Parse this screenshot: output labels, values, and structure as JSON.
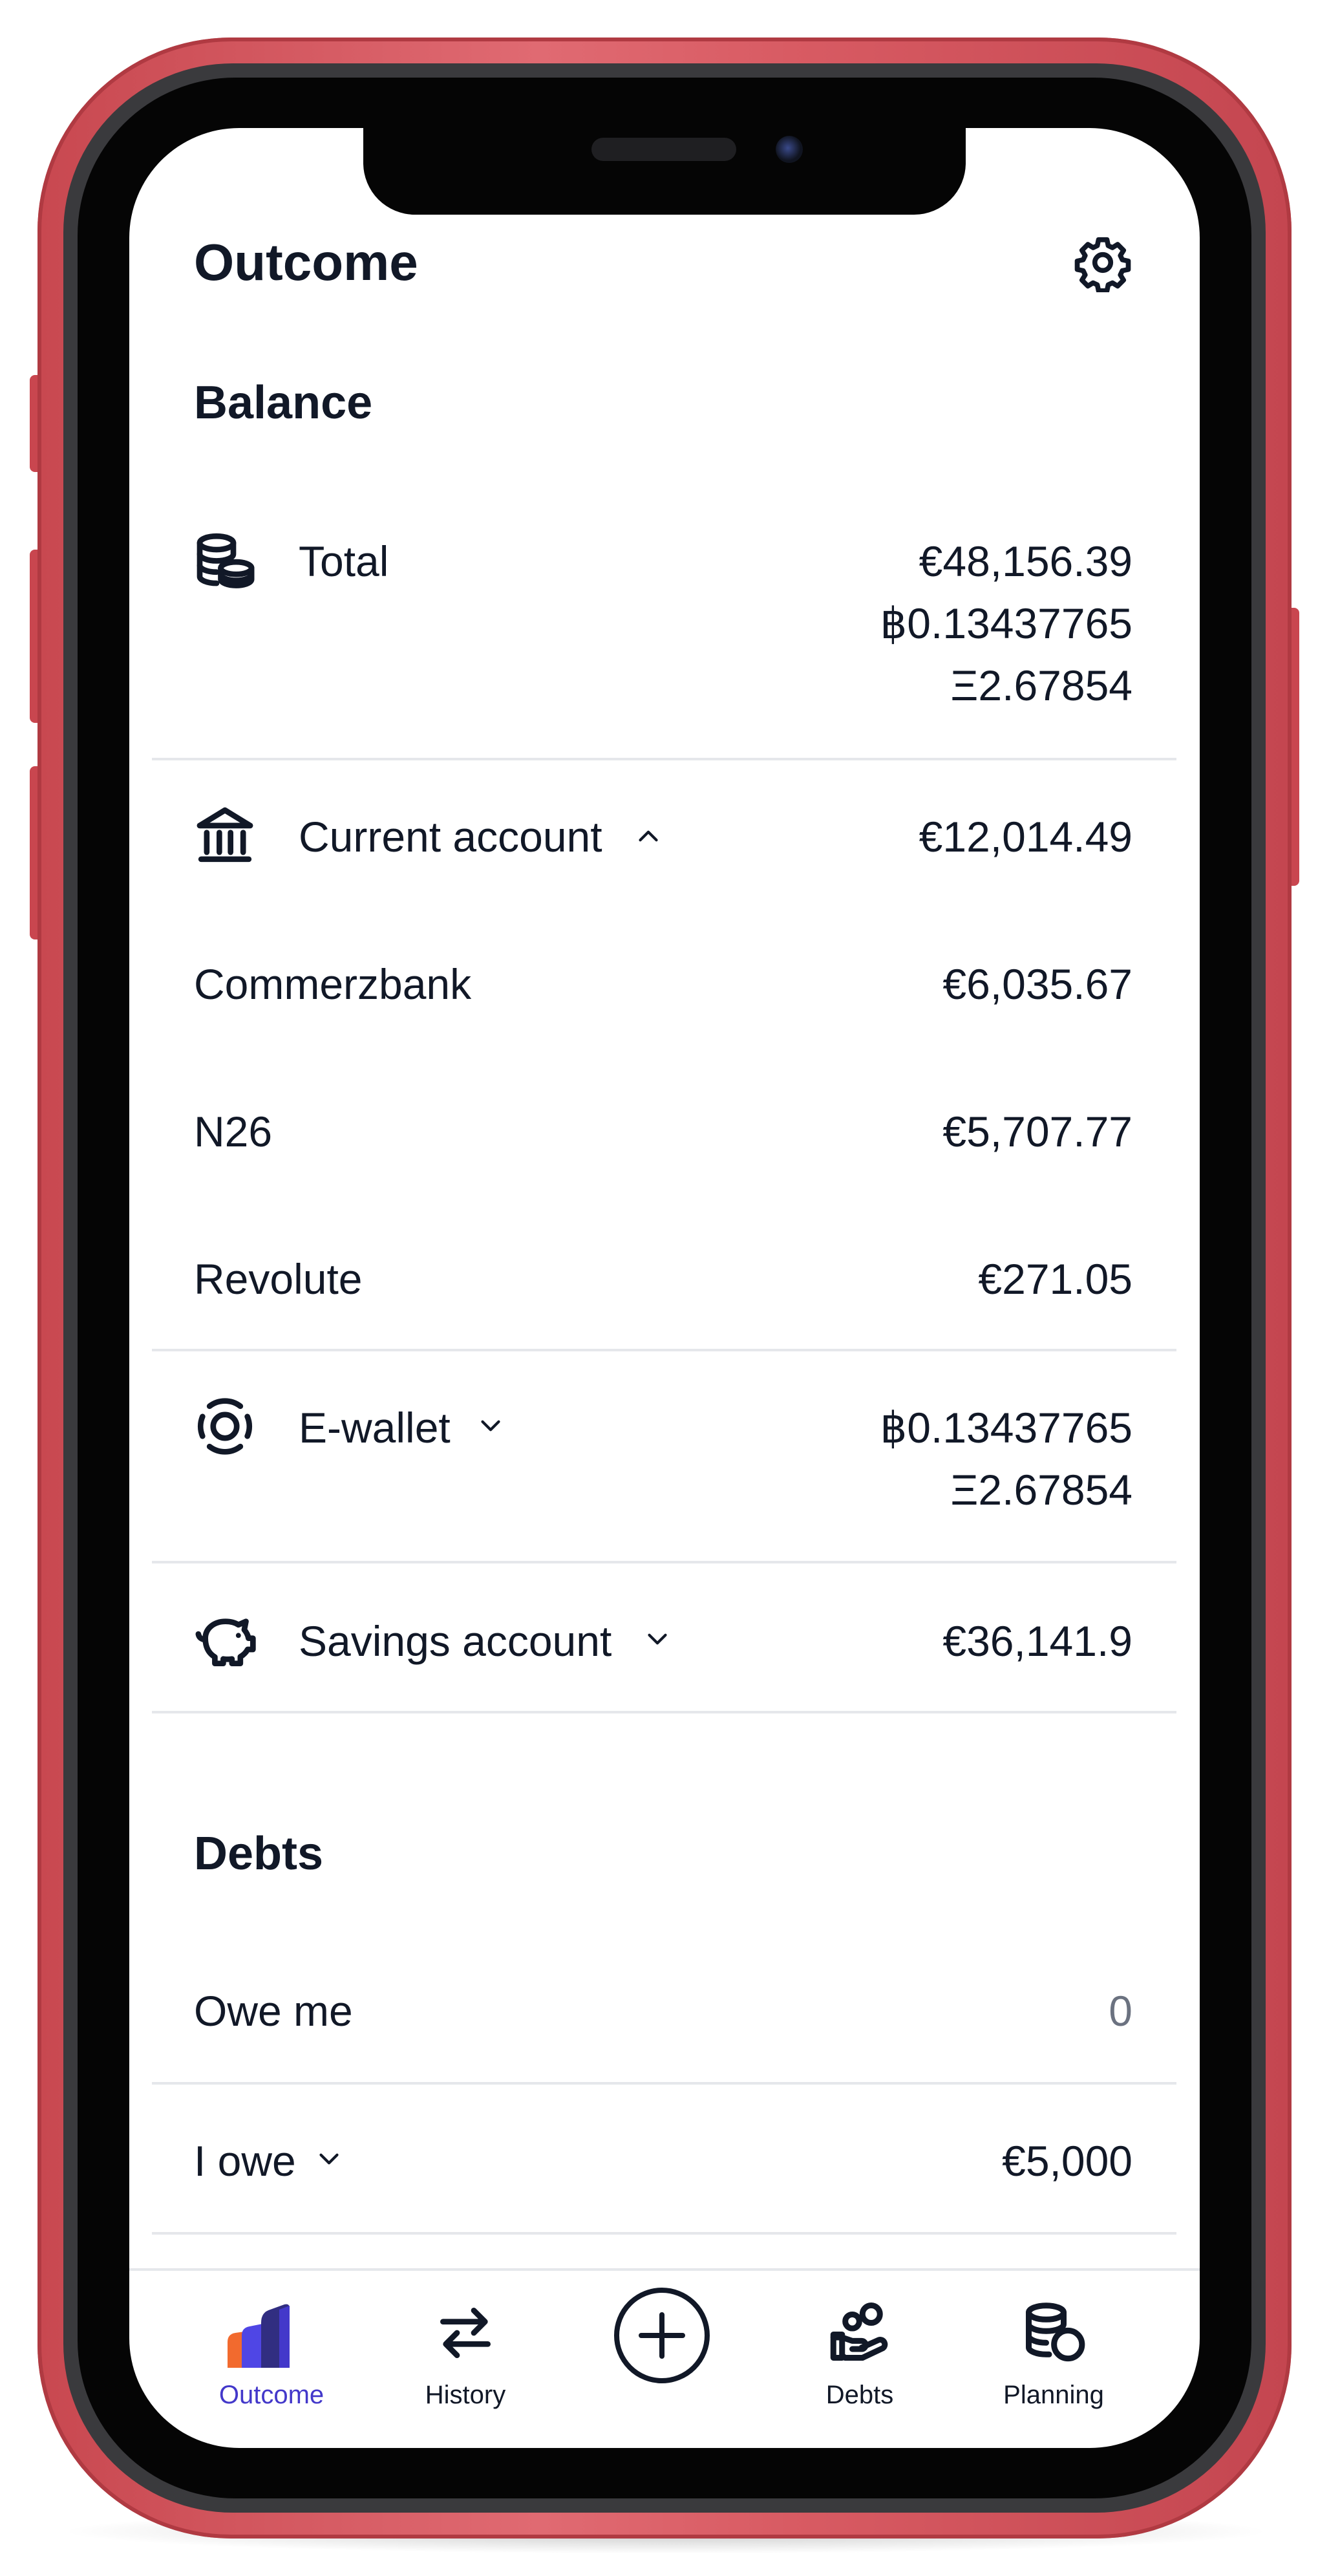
{
  "header": {
    "title": "Outcome",
    "settings_icon": "gear-icon"
  },
  "balance": {
    "heading": "Balance",
    "total": {
      "label": "Total",
      "icon": "coins-icon",
      "values": [
        "€48,156.39",
        "฿0.13437765",
        "Ξ2.67854"
      ]
    },
    "current_account": {
      "label": "Current account",
      "icon": "bank-icon",
      "value": "€12,014.49",
      "expanded": true,
      "items": [
        {
          "name": "Commerzbank",
          "value": "€6,035.67"
        },
        {
          "name": "N26",
          "value": "€5,707.77"
        },
        {
          "name": "Revolute",
          "value": "€271.05"
        }
      ]
    },
    "e_wallet": {
      "label": "E-wallet",
      "icon": "wallet-icon",
      "values": [
        "฿0.13437765",
        "Ξ2.67854"
      ]
    },
    "savings_account": {
      "label": "Savings account",
      "icon": "piggy-bank-icon",
      "value": "€36,141.9"
    }
  },
  "debts": {
    "heading": "Debts",
    "owe_me": {
      "label": "Owe me",
      "value": "0"
    },
    "i_owe": {
      "label": "I owe",
      "value": "€5,000"
    }
  },
  "tabbar": {
    "tabs": [
      {
        "label": "Outcome",
        "icon": "bar-chart-icon",
        "active": true
      },
      {
        "label": "History",
        "icon": "arrows-swap-icon",
        "active": false
      },
      {
        "label": "",
        "icon": "plus-circle-icon",
        "active": false
      },
      {
        "label": "Debts",
        "icon": "hand-coins-icon",
        "active": false
      },
      {
        "label": "Planning",
        "icon": "coins-stack-icon",
        "active": false
      }
    ]
  },
  "colors": {
    "accent": "#4338ca",
    "text": "#111827",
    "muted": "#6b7280",
    "frame": "#d85b63",
    "divider": "#e5e7eb"
  }
}
